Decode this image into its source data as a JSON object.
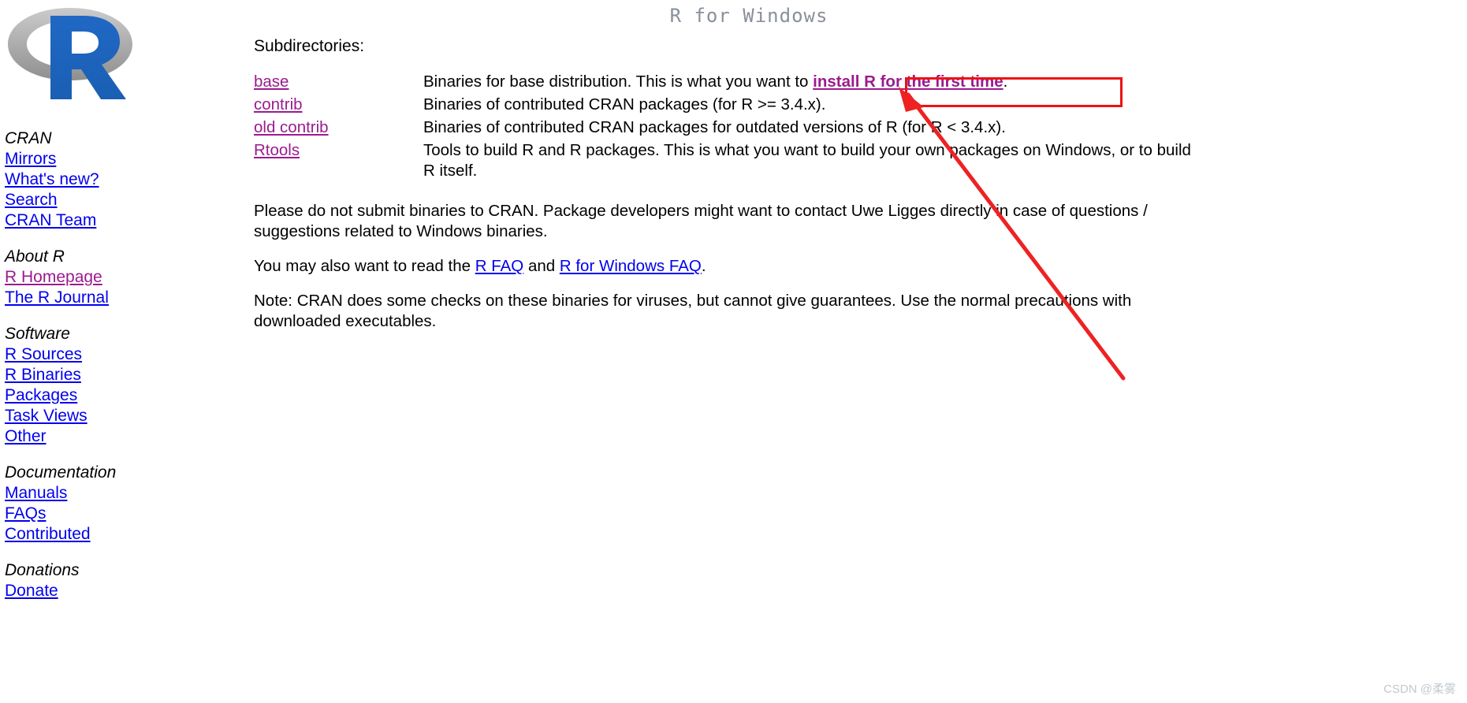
{
  "page": {
    "title": "R for Windows",
    "watermark": "CSDN @柔雾"
  },
  "sidebar": {
    "logo_alt": "r-logo",
    "groups": [
      {
        "heading": "CRAN",
        "links": [
          {
            "label": "Mirrors",
            "visited": false
          },
          {
            "label": "What's new?",
            "visited": false
          },
          {
            "label": "Search",
            "visited": false
          },
          {
            "label": "CRAN Team",
            "visited": false
          }
        ]
      },
      {
        "heading": "About R",
        "links": [
          {
            "label": "R Homepage",
            "visited": true
          },
          {
            "label": "The R Journal",
            "visited": false
          }
        ]
      },
      {
        "heading": "Software",
        "links": [
          {
            "label": "R Sources",
            "visited": false
          },
          {
            "label": "R Binaries",
            "visited": false
          },
          {
            "label": "Packages",
            "visited": false
          },
          {
            "label": "Task Views",
            "visited": false
          },
          {
            "label": "Other",
            "visited": false
          }
        ]
      },
      {
        "heading": "Documentation",
        "links": [
          {
            "label": "Manuals",
            "visited": false
          },
          {
            "label": "FAQs",
            "visited": false
          },
          {
            "label": "Contributed",
            "visited": false
          }
        ]
      },
      {
        "heading": "Donations",
        "links": [
          {
            "label": "Donate",
            "visited": false
          }
        ]
      }
    ]
  },
  "main": {
    "subdirectories_label": "Subdirectories:",
    "rows": [
      {
        "name": "base",
        "desc_before": "Binaries for base distribution. This is what you want to ",
        "link": "install R for the first time",
        "desc_after": "."
      },
      {
        "name": "contrib",
        "desc_before": "Binaries of contributed CRAN packages (for R >= 3.4.x).",
        "link": "",
        "desc_after": ""
      },
      {
        "name": "old contrib",
        "desc_before": "Binaries of contributed CRAN packages for outdated versions of R (for R < 3.4.x).",
        "link": "",
        "desc_after": ""
      },
      {
        "name": "Rtools",
        "desc_before": "Tools to build R and R packages. This is what you want to build your own packages on Windows, or to build R itself.",
        "link": "",
        "desc_after": ""
      }
    ],
    "para_submit": "Please do not submit binaries to CRAN. Package developers might want to contact Uwe Ligges directly in case of questions / suggestions related to Windows binaries.",
    "para_faq": {
      "before": "You may also want to read the ",
      "link1": "R FAQ",
      "middle": " and ",
      "link2": "R for Windows FAQ",
      "after": "."
    },
    "para_note": "Note: CRAN does some checks on these binaries for viruses, but cannot give guarantees. Use the normal precautions with downloaded executables."
  },
  "annotations": {
    "highlight_color": "#ee1111",
    "arrow_color": "#ee2222",
    "highlight_target": "install R for the first time"
  },
  "colors": {
    "link": "#0000ee",
    "visited_link": "#9b1b8f",
    "title": "#8a9099",
    "logo_blue": "#1f65b7",
    "logo_gray": "#b8b8b8"
  }
}
